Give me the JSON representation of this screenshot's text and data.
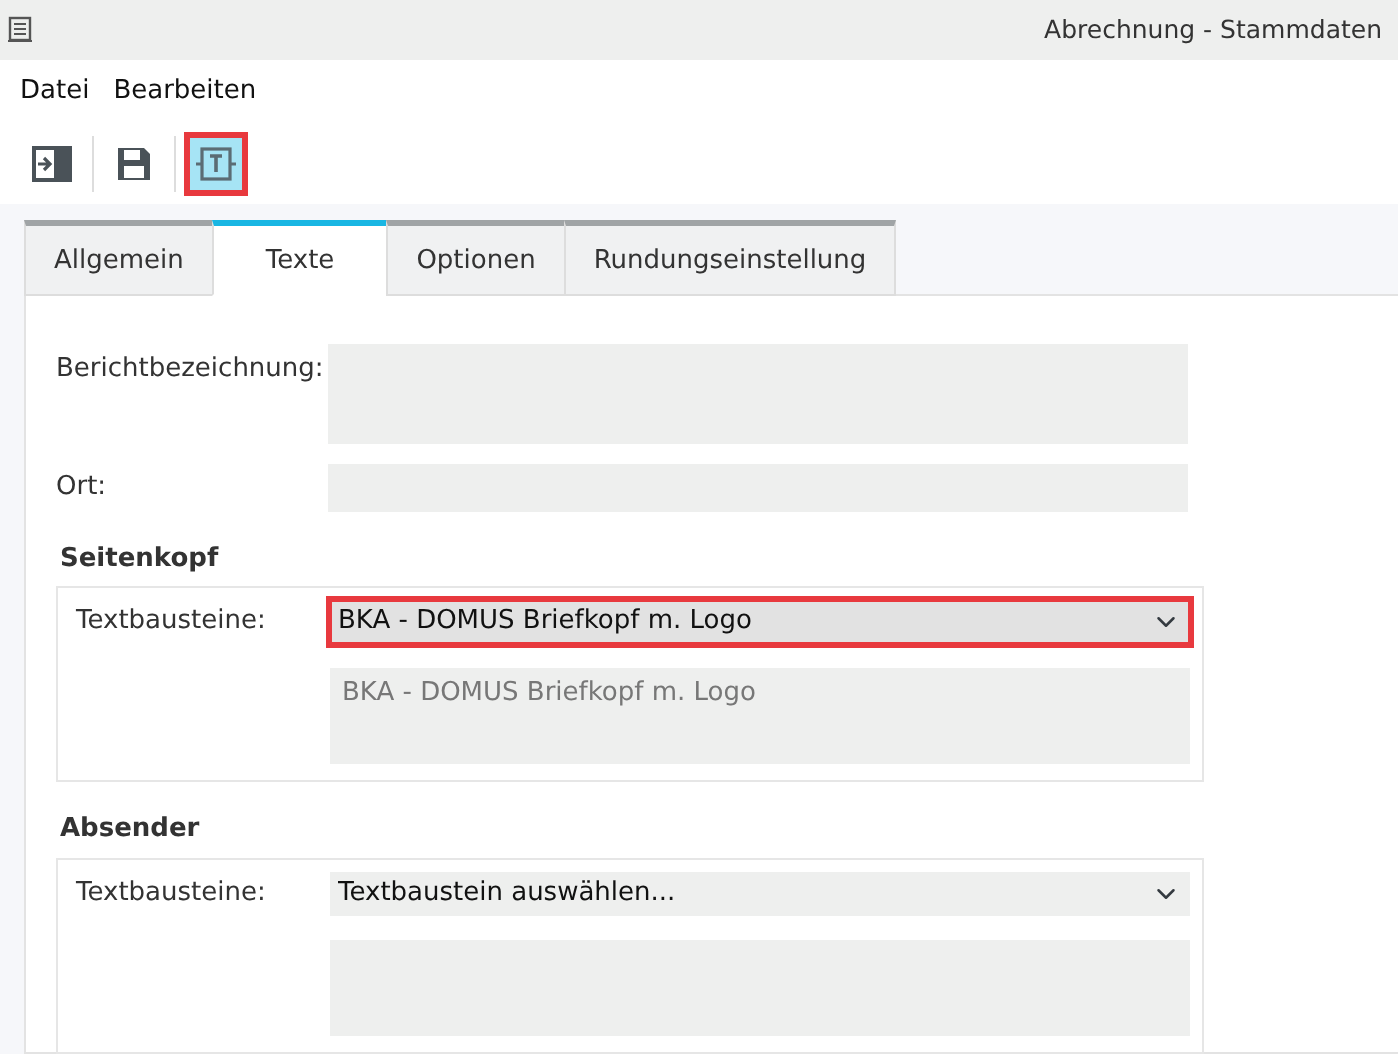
{
  "window": {
    "title": "Abrechnung - Stammdaten"
  },
  "menu": [
    "Datei",
    "Bearbeiten"
  ],
  "toolbar": [
    {
      "kind": "exit",
      "highlighted": false
    },
    {
      "kind": "save",
      "highlighted": false
    },
    {
      "kind": "text",
      "highlighted": true
    }
  ],
  "tabs": [
    {
      "label": "Allgemein",
      "selected": false
    },
    {
      "label": "Texte",
      "selected": true
    },
    {
      "label": "Optionen",
      "selected": false
    },
    {
      "label": "Rundungseinstellung",
      "selected": false
    }
  ],
  "fields": [
    {
      "label": "Berichtbezeichnung:",
      "kind": "textarea"
    },
    {
      "label": "Ort:",
      "kind": "input"
    }
  ],
  "groups": [
    {
      "title": "Seitenkopf",
      "select_label": "Textbausteine:",
      "select_value": "BKA - DOMUS Briefkopf m. Logo",
      "highlighted": true,
      "preview": "BKA - DOMUS Briefkopf m. Logo"
    },
    {
      "title": "Absender",
      "select_label": "Textbausteine:",
      "select_value": "Textbaustein auswählen...",
      "highlighted": false
    }
  ]
}
